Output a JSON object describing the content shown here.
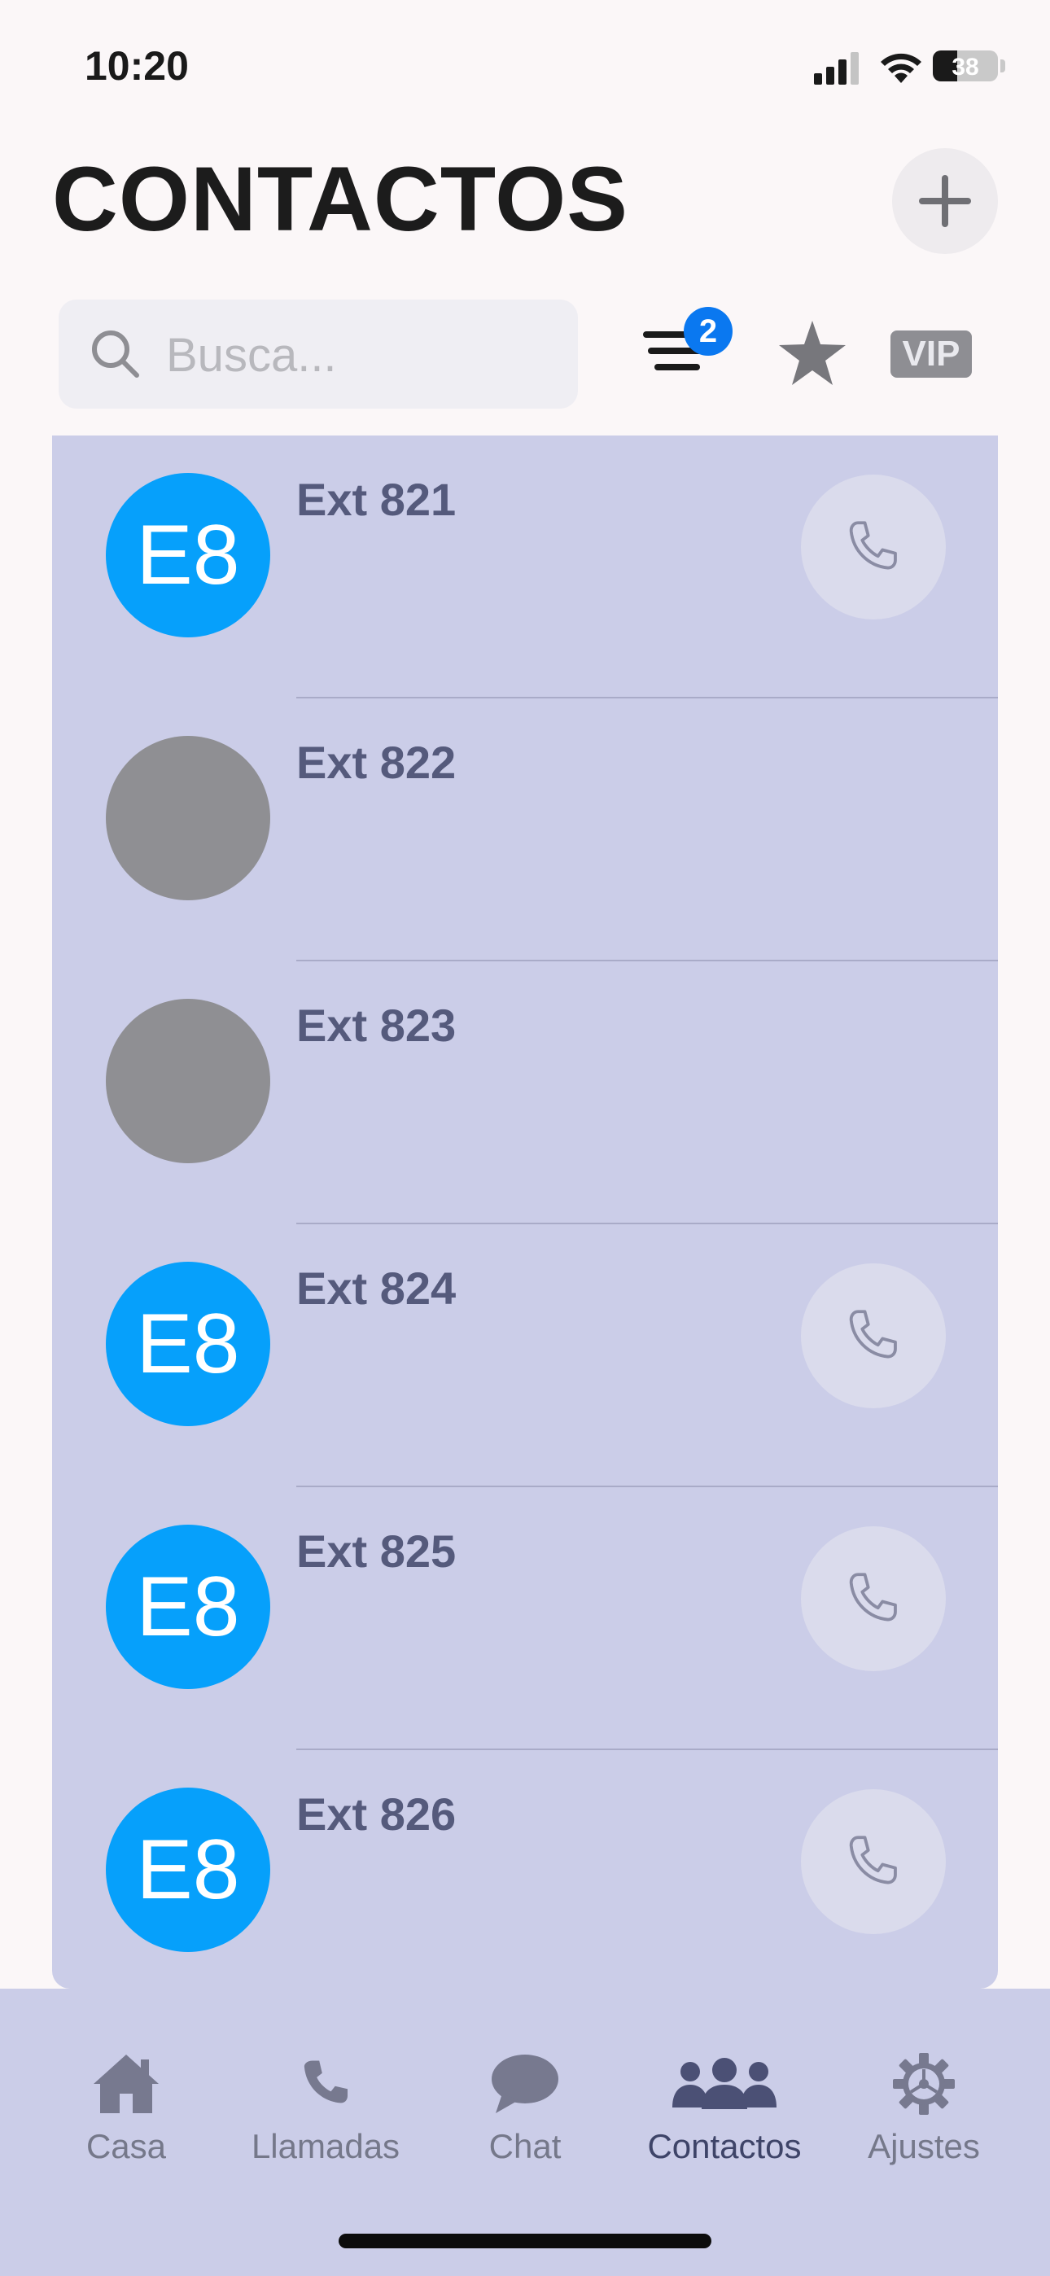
{
  "status_bar": {
    "time": "10:20",
    "battery": "38",
    "battery_level": 0.38
  },
  "header": {
    "title": "CONTACTOS"
  },
  "search": {
    "placeholder": "Busca..."
  },
  "toolbar": {
    "filter_badge": "2",
    "vip_label": "VIP"
  },
  "contacts": [
    {
      "name": "Ext 821",
      "initials": "E8",
      "avatar": "blue",
      "has_call": true
    },
    {
      "name": "Ext 822",
      "initials": "",
      "avatar": "gray",
      "has_call": false
    },
    {
      "name": "Ext 823",
      "initials": "",
      "avatar": "gray",
      "has_call": false
    },
    {
      "name": "Ext 824",
      "initials": "E8",
      "avatar": "blue",
      "has_call": true
    },
    {
      "name": "Ext 825",
      "initials": "E8",
      "avatar": "blue",
      "has_call": true
    },
    {
      "name": "Ext 826",
      "initials": "E8",
      "avatar": "blue",
      "has_call": true
    }
  ],
  "tabs": [
    {
      "label": "Casa",
      "icon": "house-icon"
    },
    {
      "label": "Llamadas",
      "icon": "phone-icon"
    },
    {
      "label": "Chat",
      "icon": "chat-bubble-icon"
    },
    {
      "label": "Contactos",
      "icon": "people-icon",
      "active": true
    },
    {
      "label": "Ajustes",
      "icon": "gear-icon"
    }
  ],
  "colors": {
    "accent": "#06a0fb",
    "list_bg": "#cbcde8",
    "badge": "#0a78f0"
  }
}
